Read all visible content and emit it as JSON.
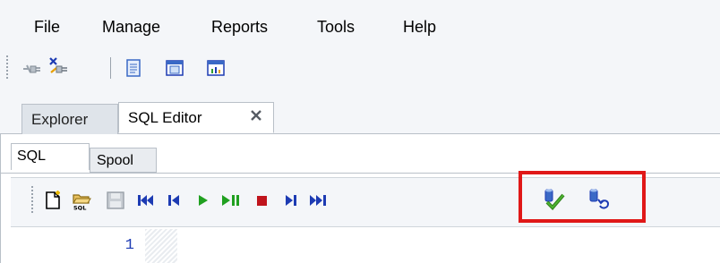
{
  "menu": {
    "items": [
      "File",
      "Manage",
      "Reports",
      "Tools",
      "Help"
    ]
  },
  "toolbar": {
    "icons": [
      "disconnect-icon",
      "connect-icon",
      "document-icon",
      "window-icon",
      "chart-icon"
    ]
  },
  "tabs": {
    "explorer": "Explorer",
    "sql_editor": "SQL Editor"
  },
  "subtabs": {
    "sql": "SQL",
    "spool": "Spool"
  },
  "editor_toolbar": {
    "icons": [
      "new-icon",
      "open-sql-icon",
      "save-icon",
      "first-icon",
      "previous-icon",
      "run-icon",
      "run-step-icon",
      "stop-icon",
      "next-icon",
      "last-icon",
      "commit-icon",
      "rollback-icon"
    ]
  },
  "editor": {
    "line_number": "1",
    "content": ""
  },
  "colors": {
    "accent": "#1d3bb3",
    "highlight": "#e01818",
    "run": "#20a020",
    "stop": "#c0141c"
  }
}
